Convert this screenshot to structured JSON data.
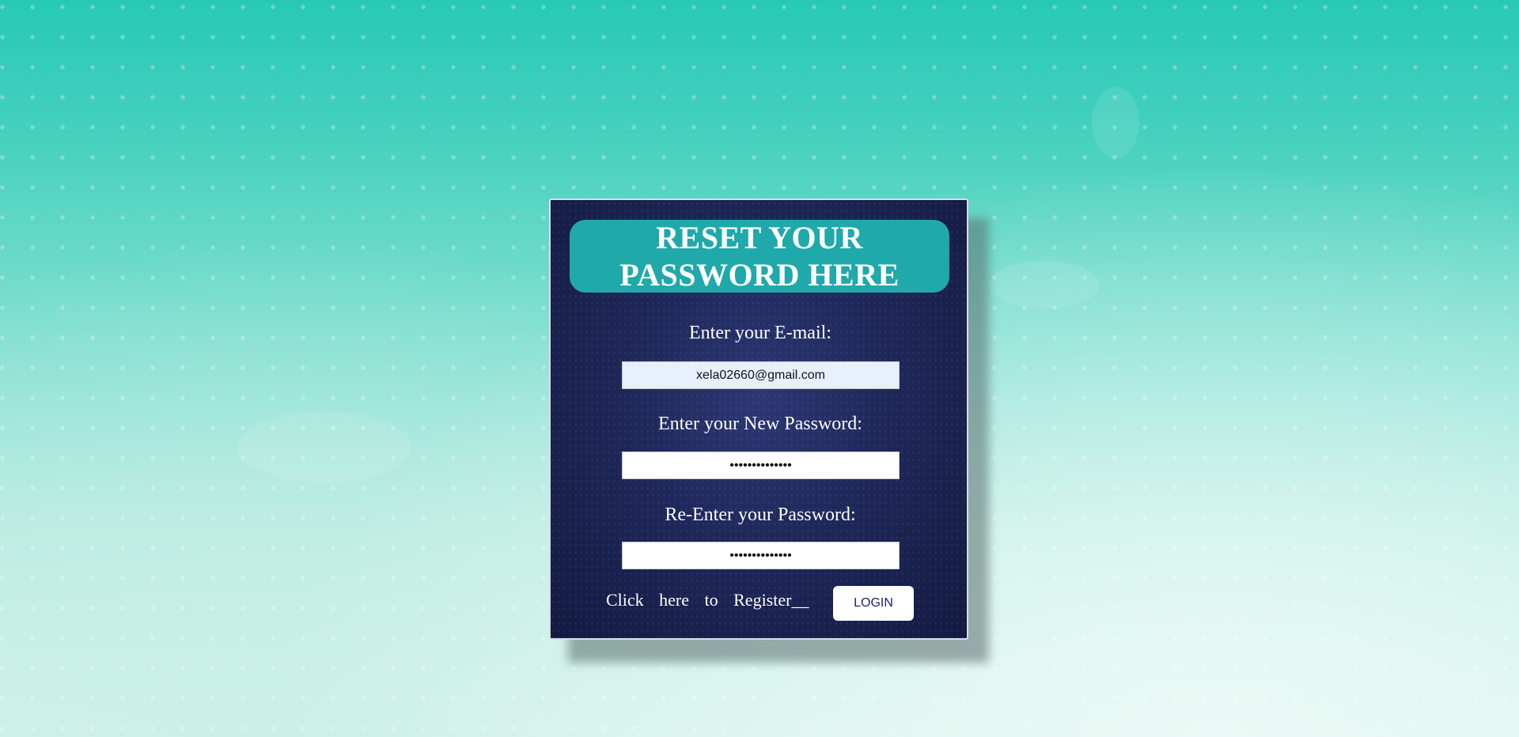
{
  "page": {
    "background_colors": [
      "#27c9b6",
      "#7fdfd0",
      "#d9f4ee"
    ],
    "card_color": "#1e2759",
    "accent_color": "#1fa9ab"
  },
  "form": {
    "title": "RESET YOUR PASSWORD HERE",
    "email": {
      "label": "Enter your E-mail:",
      "value": "xela02660@gmail.com"
    },
    "new_password": {
      "label": "Enter your New Password:",
      "value": "••••••••••••••"
    },
    "confirm_password": {
      "label": "Re-Enter your Password:",
      "value": "••••••••••••••"
    },
    "register_link": "Click here to Register__",
    "login_button": "LOGIN"
  }
}
